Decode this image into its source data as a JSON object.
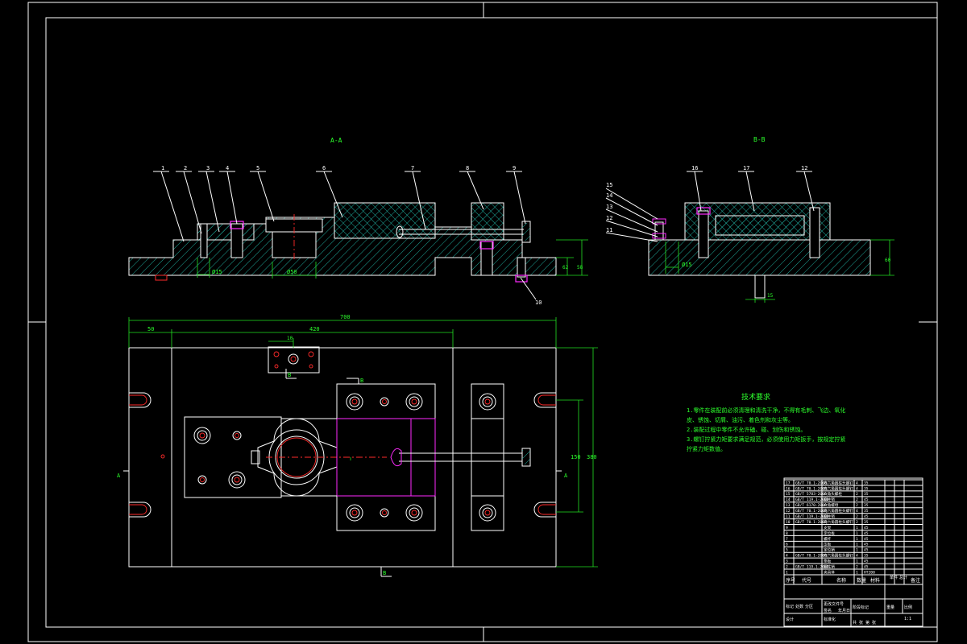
{
  "section_titles": {
    "aa": "A-A",
    "bb": "B-B"
  },
  "balloons_aa": [
    "1",
    "2",
    "3",
    "4",
    "5",
    "6",
    "7",
    "8",
    "9"
  ],
  "balloon_10": "10",
  "balloons_bb_top": [
    "16",
    "17",
    "12"
  ],
  "balloons_bb_left": [
    "15",
    "14",
    "13",
    "12",
    "11"
  ],
  "dimensions": {
    "overall_width": "700",
    "left_offset": "50",
    "inner_width": "420",
    "small_offset": "10",
    "right_height_outer": "380",
    "right_height_inner": "150",
    "aa_dim1": "Ø15",
    "aa_dim2": "Ø50",
    "aa_dim3": "62",
    "aa_dim4": "58",
    "bb_dim1": "Ø15",
    "bb_dim2": "60",
    "bb_dim3": "15"
  },
  "view_markers": {
    "a_left": "A",
    "a_right": "A",
    "b_top": "B",
    "b_bottom": "B",
    "b_mid": "B"
  },
  "tech_requirements": {
    "title": "技术要求",
    "lines": [
      "1.零件在装配前必须清理和清洗干净，不得有毛刺、飞边、氧化",
      "皮、锈蚀、切屑、油污、着色剂和灰尘等。",
      "2.装配过程中零件不允许磕、碰、划伤和锈蚀。",
      "3.螺钉拧紧力矩要求满足规范，必须使用力矩扳手，按规定拧紧",
      "拧紧力矩数值。"
    ]
  },
  "title_block": {
    "header": {
      "seq": "序号",
      "code": "代号",
      "name": "名称",
      "qty": "数量",
      "material": "材料",
      "unit_weight": "单件",
      "total_weight": "总计",
      "note": "备注"
    },
    "rows": [
      {
        "seq": "17",
        "code": "GB/T 70.1-2000",
        "name": "内六角圆柱头螺钉",
        "qty": "4",
        "material": "35"
      },
      {
        "seq": "16",
        "code": "GB/T 70.1-2000",
        "name": "内六角圆柱头螺钉",
        "qty": "4",
        "material": "35"
      },
      {
        "seq": "15",
        "code": "GB/T 5783-2000",
        "name": "六角头螺栓",
        "qty": "2",
        "material": "35"
      },
      {
        "seq": "14",
        "code": "GB/T 119.1-2000",
        "name": "圆柱销",
        "qty": "2",
        "material": "45"
      },
      {
        "seq": "13",
        "code": "GB/T 6170-2000",
        "name": "六角螺母",
        "qty": "2",
        "material": "35"
      },
      {
        "seq": "12",
        "code": "GB/T 70.1-2000",
        "name": "内六角圆柱头螺钉",
        "qty": "4",
        "material": "35"
      },
      {
        "seq": "11",
        "code": "GB/T 119.1-2000",
        "name": "圆柱销",
        "qty": "2",
        "material": "45"
      },
      {
        "seq": "10",
        "code": "GB/T 70.1-2000",
        "name": "内六角圆柱头螺钉",
        "qty": "2",
        "material": "35"
      },
      {
        "seq": "9",
        "code": "",
        "name": "支架",
        "qty": "1",
        "material": "45"
      },
      {
        "seq": "8",
        "code": "",
        "name": "定位板",
        "qty": "1",
        "material": "45"
      },
      {
        "seq": "7",
        "code": "",
        "name": "螺杆",
        "qty": "1",
        "material": "45"
      },
      {
        "seq": "6",
        "code": "",
        "name": "压板",
        "qty": "1",
        "material": "45"
      },
      {
        "seq": "5",
        "code": "",
        "name": "定位销",
        "qty": "1",
        "material": "45"
      },
      {
        "seq": "4",
        "code": "GB/T 70.1-2000",
        "name": "内六角圆柱头螺钉",
        "qty": "4",
        "material": "35"
      },
      {
        "seq": "3",
        "code": "",
        "name": "垫板",
        "qty": "1",
        "material": "45"
      },
      {
        "seq": "2",
        "code": "GB/T 119.1-2000",
        "name": "圆柱销",
        "qty": "2",
        "material": "45"
      },
      {
        "seq": "1",
        "code": "",
        "name": "夹具体",
        "qty": "1",
        "material": "HT200"
      }
    ],
    "footer": {
      "mark": "标记",
      "count": "处数",
      "zone": "分区",
      "change_doc": "更改文件号",
      "signature": "签名",
      "date": "年月日",
      "designer": "设计",
      "standard": "标准化",
      "stage": "阶段标记",
      "weight": "重量",
      "scale": "比例",
      "scale_value": "1:1",
      "sheet": "共 张 第 张"
    }
  },
  "colors": {
    "background": "#000000",
    "outline": "#ffffff",
    "dimension": "#22e022",
    "text_green": "#2cff2c",
    "hatch": "#1fa89a",
    "hidden_red": "#ff2a2a",
    "magenta": "#ff2aff"
  }
}
